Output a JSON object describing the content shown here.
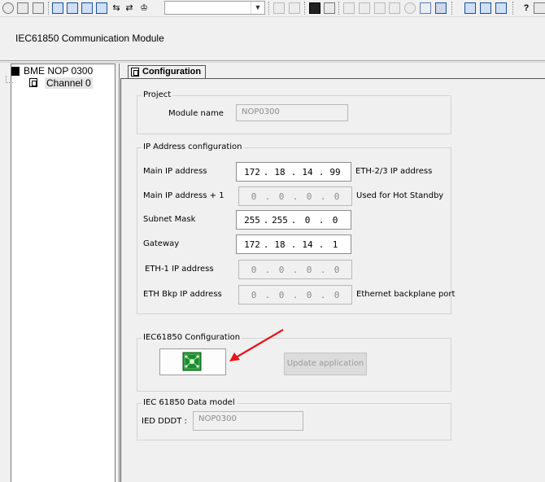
{
  "module_title": "IEC61850 Communication Module",
  "tree": {
    "root_label": "BME NOP 0300",
    "channel_label": "Channel 0"
  },
  "tab": {
    "label": "Configuration"
  },
  "project": {
    "legend": "Project",
    "module_name_label": "Module name",
    "module_name_value": "NOP0300"
  },
  "ip_config": {
    "legend": "IP Address configuration",
    "rows": [
      {
        "label": "Main IP address",
        "octets": [
          "172",
          "18",
          "14",
          "99"
        ],
        "note": "ETH-2/3 IP address",
        "enabled": true
      },
      {
        "label": "Main IP address + 1",
        "octets": [
          "0",
          "0",
          "0",
          "0"
        ],
        "note": "Used for Hot Standby",
        "enabled": false
      },
      {
        "label": "Subnet Mask",
        "octets": [
          "255",
          "255",
          "0",
          "0"
        ],
        "note": "",
        "enabled": true
      },
      {
        "label": "Gateway",
        "octets": [
          "172",
          "18",
          "14",
          "1"
        ],
        "note": "",
        "enabled": true
      },
      {
        "label": "ETH-1 IP address",
        "octets": [
          "0",
          "0",
          "0",
          "0"
        ],
        "note": "",
        "enabled": false
      },
      {
        "label": "ETH Bkp IP address",
        "octets": [
          "0",
          "0",
          "0",
          "0"
        ],
        "note": "Ethernet backplane port",
        "enabled": false
      }
    ]
  },
  "iec_config": {
    "legend": "IEC61850 Configuration",
    "update_button": "Update application"
  },
  "data_model": {
    "legend": "IEC 61850 Data model",
    "ied_label": "IED DDDT :",
    "ied_value": "NOP0300"
  },
  "toolbar": {
    "combo_value": "",
    "help_glyph": "?"
  },
  "colors": {
    "annotation_arrow": "#e8141a",
    "config_icon_green": "#1e8c2e"
  }
}
